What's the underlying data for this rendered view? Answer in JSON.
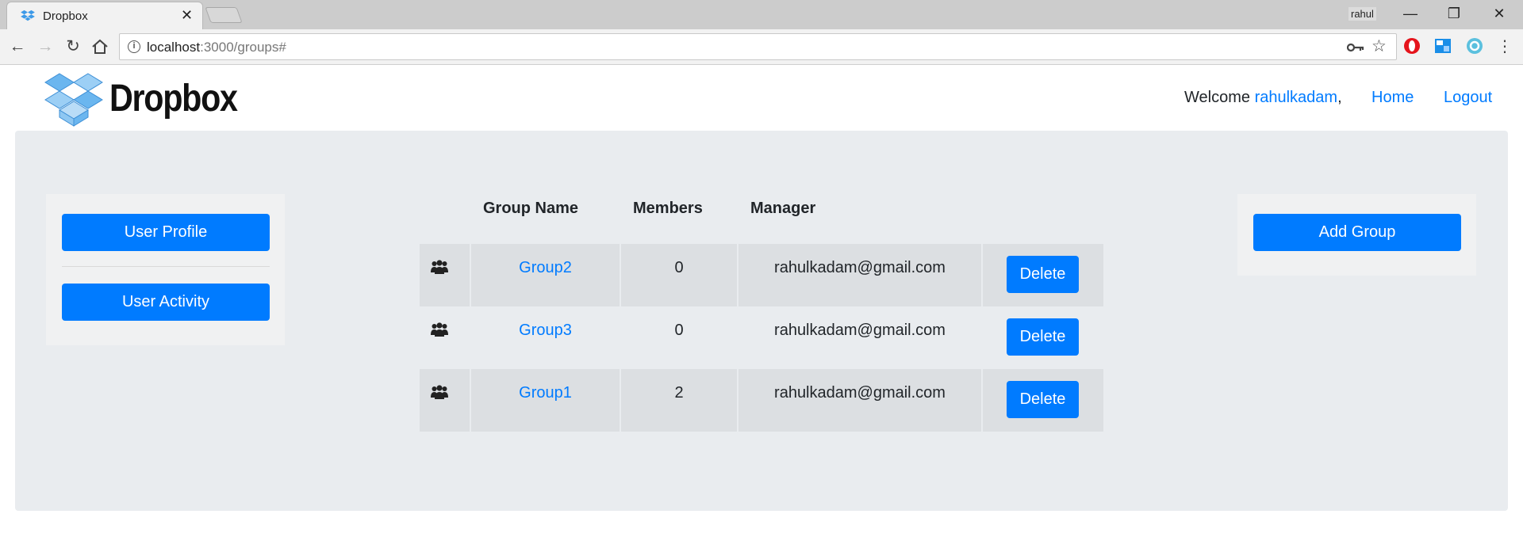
{
  "browser": {
    "tab_title": "Dropbox",
    "tab_close": "✕",
    "window_user": "rahul",
    "minimize": "—",
    "restore": "❐",
    "close": "✕",
    "address_host": "localhost",
    "address_path": ":3000/groups#"
  },
  "header": {
    "logo_text": "Dropbox",
    "welcome_label": "Welcome",
    "username": "rahulkadam",
    "comma": ",",
    "home_link": "Home",
    "logout_link": "Logout"
  },
  "sidebar": {
    "user_profile_label": "User Profile",
    "user_activity_label": "User Activity"
  },
  "right_panel": {
    "add_group_label": "Add Group"
  },
  "table": {
    "headers": {
      "group_name": "Group Name",
      "members": "Members",
      "manager": "Manager"
    },
    "rows": [
      {
        "group_name": "Group2",
        "members": "0",
        "manager": "rahulkadam@gmail.com",
        "delete_label": "Delete"
      },
      {
        "group_name": "Group3",
        "members": "0",
        "manager": "rahulkadam@gmail.com",
        "delete_label": "Delete"
      },
      {
        "group_name": "Group1",
        "members": "2",
        "manager": "rahulkadam@gmail.com",
        "delete_label": "Delete"
      }
    ]
  },
  "colors": {
    "primary": "#007bff",
    "panel_background": "#e9ecef",
    "row_shade": "#dcdfe2",
    "card_background": "#f0f1f2"
  },
  "icons": {
    "tab_favicon": "dropbox-icon",
    "back": "arrow-left-icon",
    "forward": "arrow-right-icon",
    "reload": "reload-icon",
    "home": "home-icon",
    "info": "info-icon",
    "key": "key-icon",
    "bookmark": "star-icon",
    "group": "users-icon"
  }
}
